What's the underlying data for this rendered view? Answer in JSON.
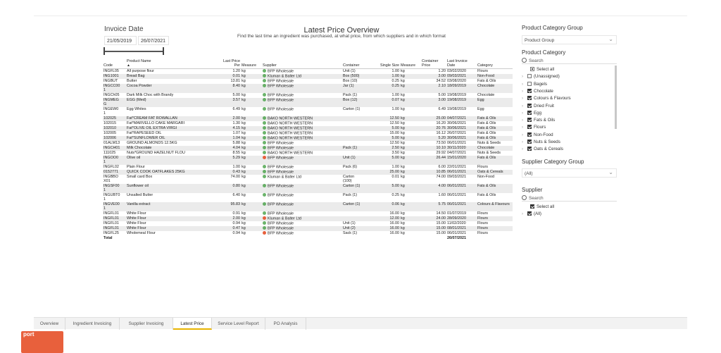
{
  "date_filter": {
    "title": "Invoice Date",
    "from": "21/05/2019",
    "to": "26/07/2021"
  },
  "header": {
    "title": "Latest Price Overview",
    "subtitle": "Find the last time an ingredient was purchased, at what price, from which suppliers and in which format"
  },
  "table": {
    "columns": [
      "Code",
      "Product Name",
      "Last Price Per",
      "Measure",
      "Supplier",
      "Container",
      "Single Size",
      "Measure",
      "Container Price",
      "Last Invoice Date",
      "Category"
    ],
    "rows": [
      [
        "INGFL05",
        "All purpose flour",
        "1.20",
        "kg",
        "BFP Wholesale",
        "Unit (1)",
        "1.00",
        "kg",
        "1.20",
        "03/02/2020",
        "Flours",
        "g"
      ],
      [
        "ING1001",
        "Bread Bag",
        "0.01",
        "kg",
        "Kluman & Balter Ltd",
        "Box (500)",
        "1.00",
        "kg",
        "3.00",
        "09/03/2021",
        "Non-Food",
        "g"
      ],
      [
        "INGBUT",
        "Butter",
        "13.81",
        "kg",
        "BFP Wholesale",
        "Box (10)",
        "0.25",
        "kg",
        "34.52",
        "03/08/2020",
        "Fats & Oils",
        "g"
      ],
      [
        "INGCC00\n1",
        "Cocoa Powder",
        "8.40",
        "kg",
        "BFP Wholesale",
        "Jar (1)",
        "0.25",
        "kg",
        "2.10",
        "18/09/2019",
        "Chocolate",
        "g"
      ],
      [
        "INGCh05",
        "Dark Milk Choc with Brandy",
        "5.00",
        "kg",
        "BFP Wholesale",
        "Pack (1)",
        "1.00",
        "kg",
        "5.00",
        "19/08/2019",
        "Chocolate",
        "g"
      ],
      [
        "INGMEG\nG",
        "EGG (Med)",
        "3.57",
        "kg",
        "BFP Wholesale",
        "Box (12)",
        "0.07",
        "kg",
        "3.00",
        "19/08/2019",
        "Egg",
        "g"
      ],
      [
        "INGEW0\n1",
        "Egg Whites",
        "6.49",
        "kg",
        "BFP Wholesale",
        "Carton (1)",
        "1.00",
        "kg",
        "6.49",
        "19/08/2019",
        "Egg",
        "g"
      ],
      [
        "102025",
        "Fat*CREAM FAT ROWALLAN",
        "2.00",
        "kg",
        "BAKO NORTH WESTERN",
        "",
        "12.50",
        "kg",
        "25.00",
        "04/07/2021",
        "Fats & Oils",
        "g"
      ],
      [
        "102015",
        "Fat*MARVELLO CAKE MARGARI",
        "1.30",
        "kg",
        "BAKO NORTH WESTERN",
        "",
        "12.50",
        "kg",
        "16.20",
        "30/06/2021",
        "Fats & Oils",
        "g"
      ],
      [
        "102010",
        "Fat*OLIVE OIL EXTRA VIRGI",
        "4.15",
        "kg",
        "BAKO NORTH WESTERN",
        "",
        "5.00",
        "kg",
        "20.76",
        "30/06/2021",
        "Fats & Oils",
        "g"
      ],
      [
        "102005",
        "Fat*RAPESEED OIL",
        "1.07",
        "kg",
        "BAKO NORTH WESTERN",
        "",
        "15.00",
        "kg",
        "16.12",
        "26/07/2021",
        "Fats & Oils",
        "g"
      ],
      [
        "102006",
        "Fat*SUNFLOWER OIL",
        "1.04",
        "kg",
        "BAKO NORTH WESTERN",
        "",
        "5.00",
        "kg",
        "5.20",
        "30/06/2021",
        "Fats & Oils",
        "g"
      ],
      [
        "01ALM13",
        "GROUND ALMONDS 12.5KG",
        "5.88",
        "kg",
        "BFP Wholesale",
        "",
        "12.50",
        "kg",
        "73.50",
        "06/01/2021",
        "Nuts & Seeds",
        "g"
      ],
      [
        "INGCH01",
        "Milk Chocolate",
        "4.04",
        "kg",
        "BFP Wholesale",
        "Pack (1)",
        "2.50",
        "kg",
        "10.10",
        "30/11/2020",
        "Chocolate",
        "g"
      ],
      [
        "111025",
        "Nuts*GROUND HAZELNUT FLOU",
        "8.55",
        "kg",
        "BAKO NORTH WESTERN",
        "",
        "3.50",
        "kg",
        "29.92",
        "04/07/2021",
        "Nuts & Seeds",
        "g"
      ],
      [
        "INGOO0\n1",
        "Olive oil",
        "5.29",
        "kg",
        "BFP Wholesale",
        "Unit (1)",
        "5.00",
        "kg",
        "26.44",
        "15/01/2020",
        "Fats & Oils",
        "w"
      ],
      [
        "INGFL02",
        "Plain Flour",
        "1.00",
        "kg",
        "BFP Wholesale",
        "Pack (6)",
        "1.00",
        "kg",
        "6.00",
        "22/01/2021",
        "Flours",
        "g"
      ],
      [
        "0152771",
        "QUICK COOK OATFLAKES 25KG",
        "0.43",
        "kg",
        "BFP Wholesale",
        "",
        "25.00",
        "kg",
        "10.85",
        "06/01/2021",
        "Oats & Cereals",
        "g"
      ],
      [
        "INGBBO\nX01",
        "Small card Box",
        "74.00",
        "kg",
        "Kluman & Balter Ltd",
        "Carton\n(100)",
        "0.01",
        "kg",
        "74.00",
        "09/03/2021",
        "Non-Food",
        "g"
      ],
      [
        "INGSF00\n1",
        "Sunflower oil",
        "0.80",
        "kg",
        "BFP Wholesale",
        "Carton (1)",
        "5.00",
        "kg",
        "4.00",
        "06/01/2021",
        "Fats & Oils",
        "g"
      ],
      [
        "INGUBT0\n1",
        "Unsalted Butter",
        "6.40",
        "kg",
        "BFP Wholesale",
        "Pack (1)",
        "0.25",
        "kg",
        "1.60",
        "06/01/2021",
        "Fats & Oils",
        "g"
      ],
      [
        "INGVE00\n1",
        "Vanilla extract",
        "95.83",
        "kg",
        "BFP Wholesale",
        "Carton (1)",
        "0.06",
        "kg",
        "5.75",
        "06/01/2021",
        "Colours & Flavours",
        "g"
      ],
      [
        "INGFL01",
        "White Flour",
        "0.91",
        "kg",
        "BFP Wholesale",
        "",
        "16.00",
        "kg",
        "14.50",
        "01/07/2019",
        "Flours",
        "g"
      ],
      [
        "INGFL01",
        "White Flour",
        "2.00",
        "kg",
        "Kluman & Balter Ltd",
        "",
        "12.00",
        "kg",
        "24.00",
        "28/09/2020",
        "Flours",
        "w"
      ],
      [
        "INGFL01",
        "White Flour",
        "0.94",
        "kg",
        "BFP Wholesale",
        "Unit (1)",
        "16.00",
        "kg",
        "15.00",
        "11/02/2020",
        "Flours",
        "g"
      ],
      [
        "INGFL01",
        "White Flour",
        "0.47",
        "kg",
        "BFP Wholesale",
        "Unit (2)",
        "16.00",
        "kg",
        "15.00",
        "08/01/2021",
        "Flours",
        "g"
      ],
      [
        "INGFL25",
        "Wholemeal Flour",
        "0.94",
        "kg",
        "BFP Wholesale",
        "Sack (1)",
        "16.00",
        "kg",
        "15.00",
        "06/01/2021",
        "Flours",
        "w"
      ]
    ],
    "total_label": "Total",
    "total_date": "26/07/2021"
  },
  "filters": {
    "product_category_group": {
      "title": "Product Category Group",
      "value": "Product Group"
    },
    "product_category": {
      "title": "Product Category",
      "search_placeholder": "Search",
      "items": [
        {
          "label": "Select all",
          "state": "partial",
          "chevron": false
        },
        {
          "label": "(Unassigned)",
          "state": "off",
          "chevron": true
        },
        {
          "label": "Bagels",
          "state": "off",
          "chevron": true
        },
        {
          "label": "Chocolate",
          "state": "on",
          "chevron": true
        },
        {
          "label": "Colours & Flavours",
          "state": "on",
          "chevron": true
        },
        {
          "label": "Dried Fruit",
          "state": "on",
          "chevron": true
        },
        {
          "label": "Egg",
          "state": "on",
          "chevron": true
        },
        {
          "label": "Fats & Oils",
          "state": "on",
          "chevron": true
        },
        {
          "label": "Flours",
          "state": "on",
          "chevron": true
        },
        {
          "label": "Non-Food",
          "state": "on",
          "chevron": true
        },
        {
          "label": "Nuts & Seeds",
          "state": "on",
          "chevron": true
        },
        {
          "label": "Oats & Cereals",
          "state": "on",
          "chevron": true
        }
      ]
    },
    "supplier_category_group": {
      "title": "Supplier Category Group",
      "value": "(All)"
    },
    "supplier": {
      "title": "Supplier",
      "search_placeholder": "Search",
      "items": [
        {
          "label": "Select all",
          "state": "on",
          "chevron": false
        },
        {
          "label": "(All)",
          "state": "on",
          "chevron": true
        }
      ]
    }
  },
  "tabs": [
    "Overview",
    "Ingredient Invoicing",
    "Supplier Invoicing",
    "Latest Price",
    "Service Level Report",
    "PO Analysis"
  ],
  "active_tab": "Latest Price",
  "brand_text": "port",
  "colors": {
    "accent_tab": "#e8b400",
    "brand": "#e8603c",
    "supplier_ok": "#3a9b3a",
    "supplier_warn": "#e8603c"
  }
}
